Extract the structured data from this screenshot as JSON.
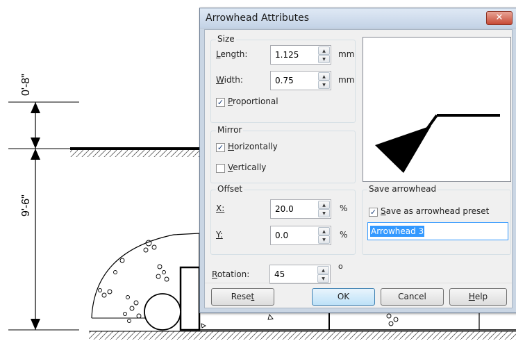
{
  "drawing": {
    "dim_top": "0'-8\"",
    "dim_bottom": "9'-6\""
  },
  "dialog": {
    "title": "Arrowhead Attributes",
    "close_glyph": "✕",
    "size": {
      "title": "Size",
      "length_label": "Length:",
      "length_value": "1.125",
      "length_unit": "mm",
      "width_label": "Width:",
      "width_value": "0.75",
      "width_unit": "mm",
      "proportional_label": "Proportional",
      "proportional_checked": true
    },
    "mirror": {
      "title": "Mirror",
      "horizontally_label": "Horizontally",
      "horizontally_checked": true,
      "vertically_label": "Vertically",
      "vertically_checked": false
    },
    "offset": {
      "title": "Offset",
      "x_label": "X:",
      "x_value": "20.0",
      "x_unit": "%",
      "y_label": "Y:",
      "y_value": "0.0",
      "y_unit": "%"
    },
    "rotation": {
      "label": "Rotation:",
      "value": "45",
      "unit": "o"
    },
    "save": {
      "title": "Save arrowhead",
      "save_preset_label": "Save as arrowhead preset",
      "save_preset_checked": true,
      "preset_name": "Arrowhead 3"
    },
    "buttons": {
      "reset": "Reset",
      "ok": "OK",
      "cancel": "Cancel",
      "help": "Help"
    }
  }
}
